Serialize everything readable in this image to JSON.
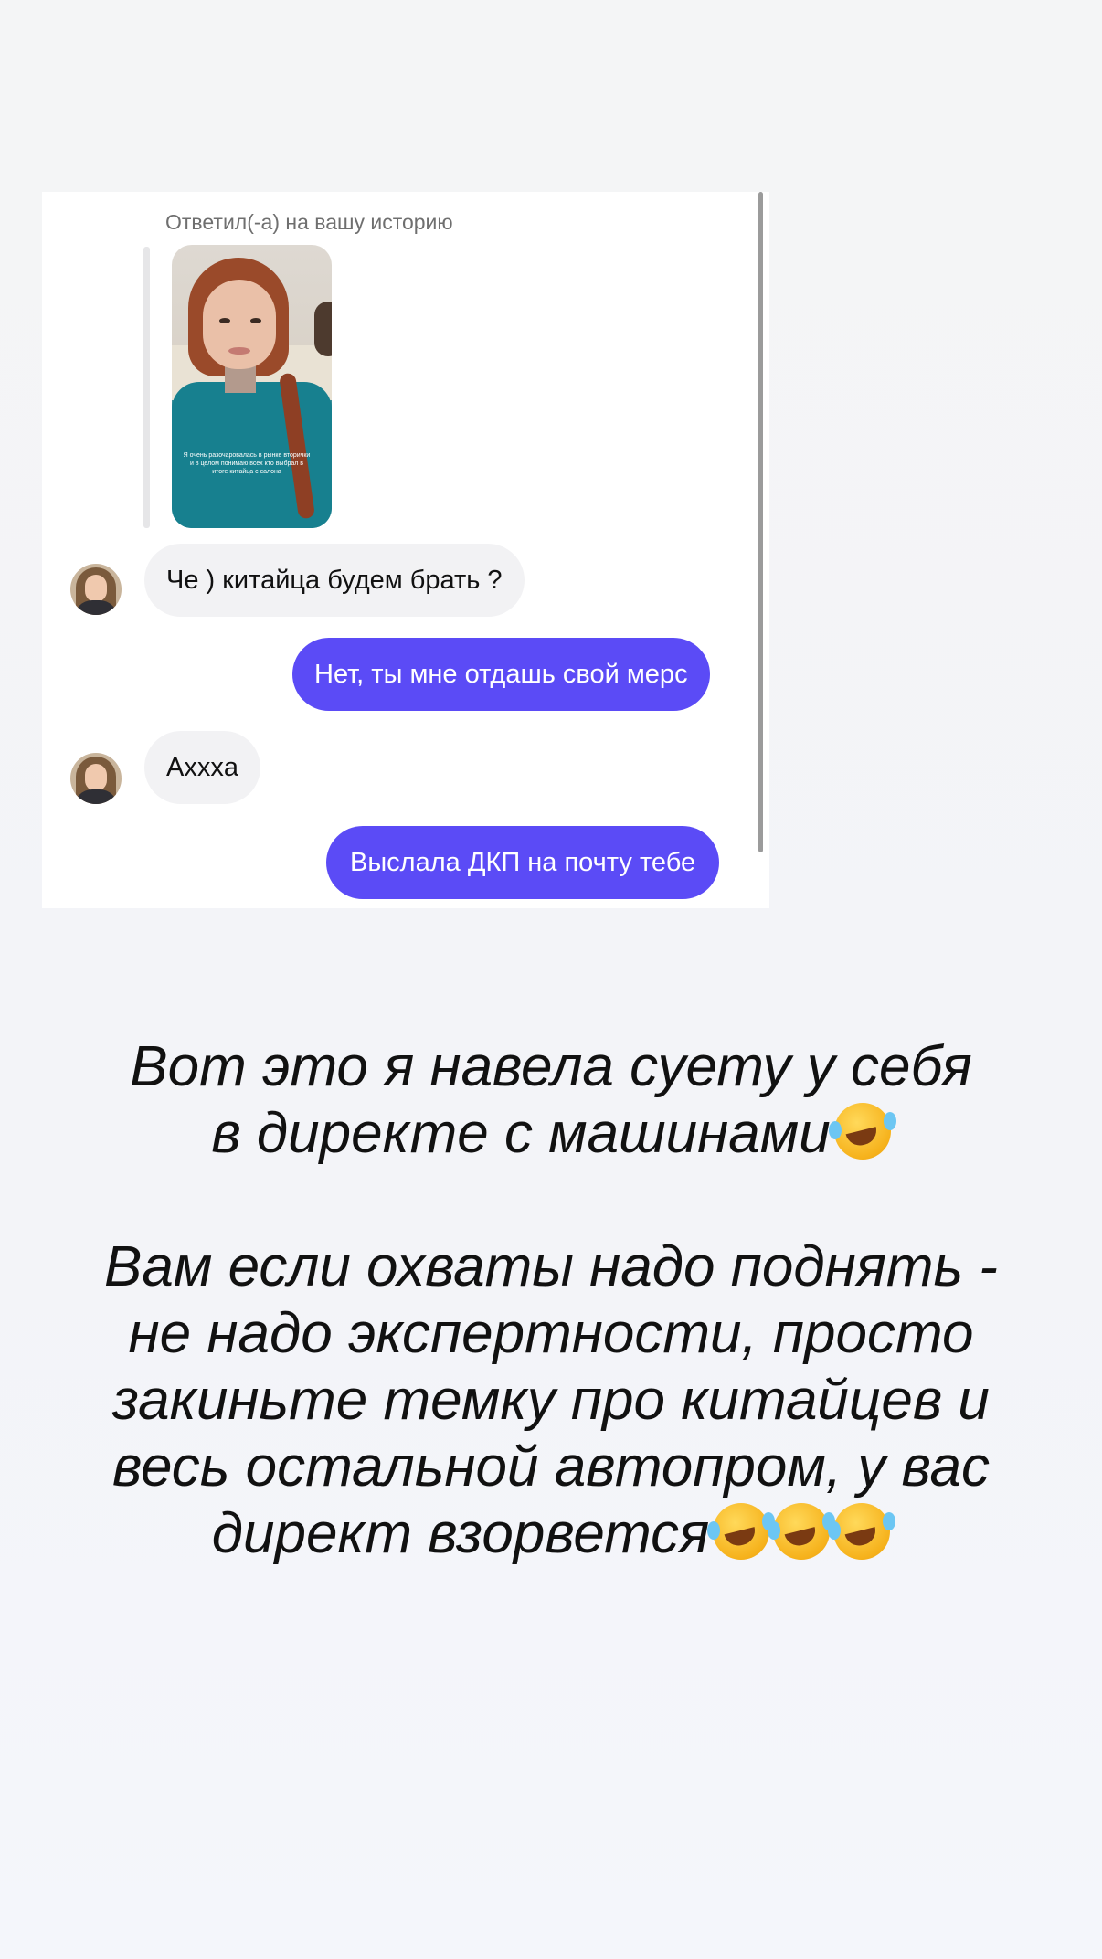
{
  "chat": {
    "reply_caption": "Ответил(-а) на вашу историю",
    "story_caption": "Я очень разочаровалась в рынке вторички и в целом понимаю всех кто выбрал в итоге китайца с салона",
    "messages": [
      {
        "direction": "incoming",
        "text": "Че ) китайца будем брать ?"
      },
      {
        "direction": "outgoing",
        "text": "Нет, ты мне отдашь свой мерс"
      },
      {
        "direction": "incoming",
        "text": "Ахххa"
      },
      {
        "direction": "outgoing",
        "text": "Выслала ДКП на почту тебе"
      }
    ],
    "colors": {
      "incoming_bubble": "#f2f2f4",
      "outgoing_bubble": "#5b4bf6"
    }
  },
  "story_text": {
    "line1": "Вот это я навела суету у себя\nв директе с машинами",
    "line2": "Вам если охваты надо поднять -\nне надо экспертности, просто\nзакиньте темку про китайцев и\nвесь остальной автопром, у вас\nдирект взорвется",
    "emoji": "rolling-on-the-floor-laughing"
  }
}
